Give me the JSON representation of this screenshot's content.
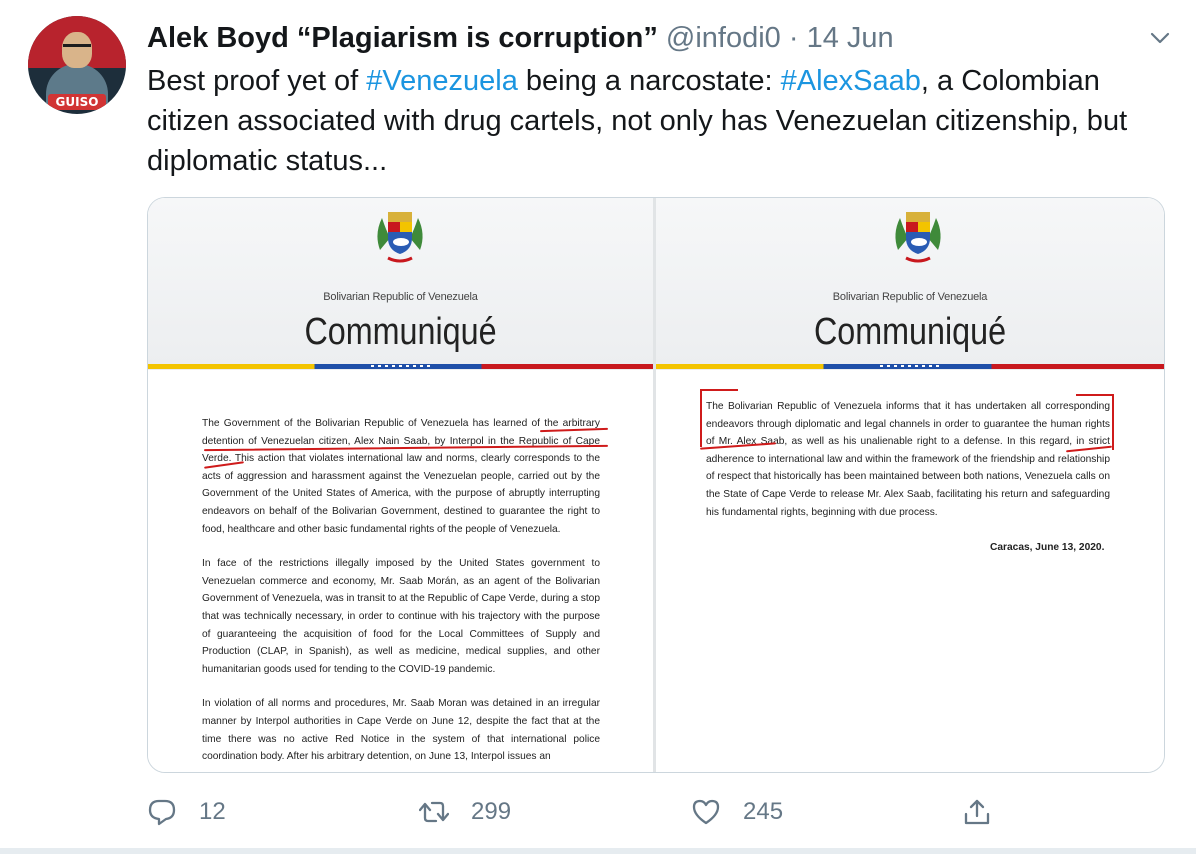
{
  "tweet": {
    "author_name": "Alek Boyd “Plagiarism is corruption”",
    "handle": "@infodi0",
    "separator": "·",
    "date": "14 Jun",
    "avatar_badge": "GUISO",
    "text": {
      "part1": "Best proof yet of ",
      "hashtag1": "#Venezuela",
      "part2": " being a narcostate: ",
      "hashtag2": "#AlexSaab",
      "part3": ", a Colombian citizen associated with drug cartels, not only has Venezuelan citizenship, but diplomatic status..."
    }
  },
  "media": {
    "left_page": {
      "republic": "Bolivarian Republic of Venezuela",
      "title": "Communiqué",
      "paragraphs": [
        "The Government of the Bolivarian Republic of Venezuela has learned of the arbitrary detention of Venezuelan citizen, Alex Nain Saab, by Interpol in the Republic of Cape Verde. This action that violates international law and norms, clearly corresponds to the acts of aggression and harassment against the Venezuelan people, carried out by the Government of the United States of America, with the purpose of abruptly interrupting endeavors on behalf of the Bolivarian Government, destined to guarantee the right to food, healthcare and other basic fundamental rights of the people of Venezuela.",
        "In face of the restrictions illegally imposed by the United States government to Venezuelan commerce and economy, Mr. Saab Morán, as an agent of the Bolivarian Government of Venezuela, was in transit to at the Republic of Cape Verde, during a stop that was technically necessary, in order to continue with his trajectory with the purpose of guaranteeing the acquisition of food for the Local Committees of Supply and Production (CLAP, in Spanish), as well as medicine, medical supplies, and other humanitarian goods used for tending to the COVID-19 pandemic.",
        "In violation of all norms and procedures, Mr. Saab Moran was detained in an irregular manner by Interpol authorities in Cape Verde on June 12, despite the fact that at the time there was no active Red Notice in the system of that international police coordination body. After his arbitrary detention, on June 13, Interpol issues an"
      ]
    },
    "right_page": {
      "republic": "Bolivarian Republic of Venezuela",
      "title": "Communiqué",
      "paragraphs": [
        "The Bolivarian Republic of Venezuela informs that it has undertaken all corresponding endeavors through diplomatic and legal channels in order to guarantee the human rights of Mr. Alex Saab, as well as his unalienable right to a defense. In this regard, in strict adherence to international law and within the framework of the friendship and relationship of respect that historically has been maintained between both nations, Venezuela calls on the State of Cape Verde to release Mr. Alex Saab, facilitating his return and safeguarding his fundamental rights, beginning with due process."
      ],
      "signature": "Caracas, June 13, 2020."
    }
  },
  "actions": {
    "replies": "12",
    "retweets": "299",
    "likes": "245"
  },
  "colors": {
    "link": "#1b95e0",
    "muted": "#657786",
    "annotation_red": "#cf1b1b"
  },
  "icons": [
    "chevron-down-icon",
    "reply-icon",
    "retweet-icon",
    "like-icon",
    "share-icon",
    "coat-of-arms-icon"
  ]
}
